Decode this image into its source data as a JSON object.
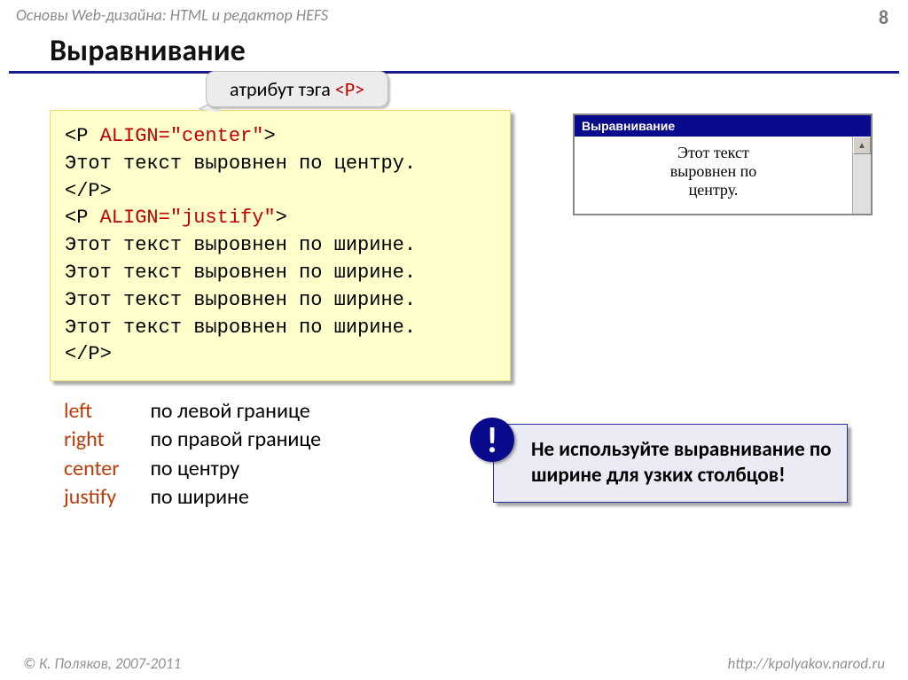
{
  "header": {
    "subject": "Основы Web-дизайна: HTML и редактор HEFS",
    "page_number": "8"
  },
  "title": "Выравнивание",
  "callout": {
    "text_prefix": "атрибут тэга ",
    "tag": "<P>"
  },
  "code": {
    "l1a": "<P ",
    "l1b": "ALIGN=\"center\"",
    "l1c": ">",
    "l2": "Этот текст выровнен по центру.",
    "l3": "</P>",
    "l4a": "<P ",
    "l4b": "ALIGN=\"justify\"",
    "l4c": ">",
    "l5": "Этот текст выровнен по ширине.",
    "l6": "Этот текст выровнен по ширине.",
    "l7": "Этот текст выровнен по ширине.",
    "l8": "Этот текст выровнен по ширине.",
    "l9": "</P>"
  },
  "result": {
    "title": "Выравнивание",
    "line1": "Этот текст",
    "line2": "выровнен по",
    "line3": "центру."
  },
  "values": {
    "left_kw": "left",
    "left_desc": "по левой границе",
    "right_kw": "right",
    "right_desc": "по правой границе",
    "center_kw": "center",
    "center_desc": "по центру",
    "justify_kw": "justify",
    "justify_desc": "по ширине"
  },
  "warning": {
    "icon": "!",
    "text": "Не используйте выравнивание по ширине для узких столбцов!"
  },
  "footer": {
    "copyright": "© К. Поляков, 2007-2011",
    "url": "http://kpolyakov.narod.ru"
  }
}
